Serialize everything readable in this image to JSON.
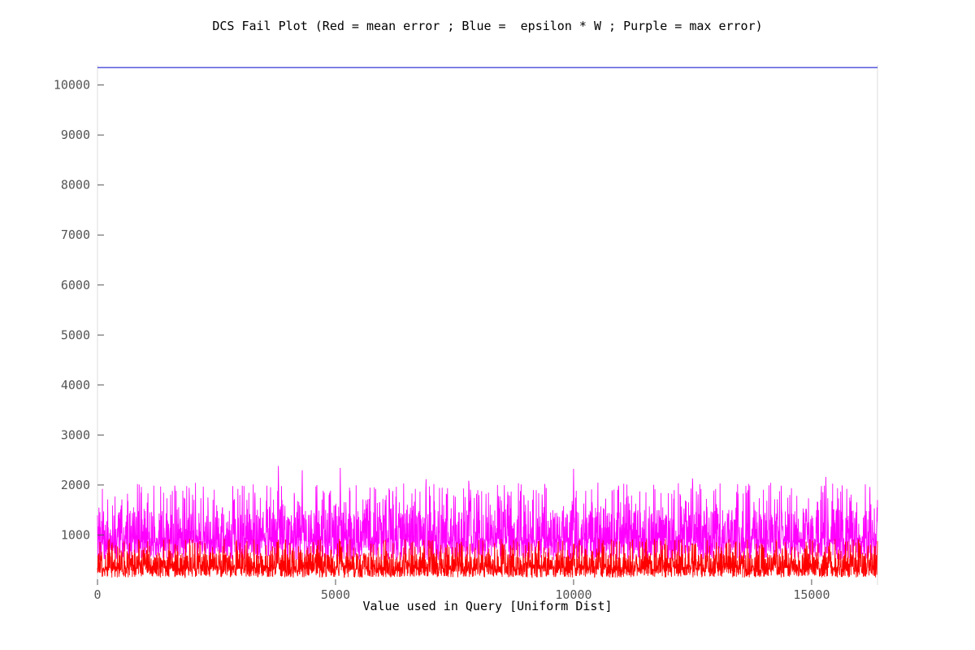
{
  "chart_data": {
    "type": "line",
    "title": "DCS Fail Plot (Red = mean error ; Blue =  epsilon * W ; Purple = max error)",
    "xlabel": "Value used in Query [Uniform Dist]",
    "ylabel": "",
    "xlim": [
      0,
      16384
    ],
    "ylim": [
      0,
      10400
    ],
    "xticks": [
      0,
      5000,
      10000,
      15000
    ],
    "yticks": [
      1000,
      2000,
      3000,
      4000,
      5000,
      6000,
      7000,
      8000,
      9000,
      10000
    ],
    "grid": false,
    "series": [
      {
        "name": "epsilon * W",
        "color": "#0000cc",
        "style": "constant",
        "value": 10350
      },
      {
        "name": "max error",
        "color": "#ff00ff",
        "style": "noisy-band",
        "typical_min": 500,
        "typical_max": 1500,
        "peak_points": [
          [
            3800,
            2500
          ],
          [
            4300,
            2390
          ],
          [
            5100,
            2400
          ],
          [
            6900,
            2320
          ],
          [
            7800,
            2350
          ],
          [
            10000,
            2400
          ],
          [
            12500,
            2380
          ],
          [
            15300,
            2330
          ],
          [
            16384,
            1700
          ]
        ]
      },
      {
        "name": "mean error",
        "color": "#ff0000",
        "style": "noisy-band",
        "typical_min": 150,
        "typical_max": 650,
        "peak_points": [
          [
            3800,
            950
          ],
          [
            5100,
            900
          ],
          [
            7000,
            920
          ],
          [
            10000,
            850
          ],
          [
            13000,
            870
          ],
          [
            16384,
            880
          ]
        ]
      }
    ]
  }
}
